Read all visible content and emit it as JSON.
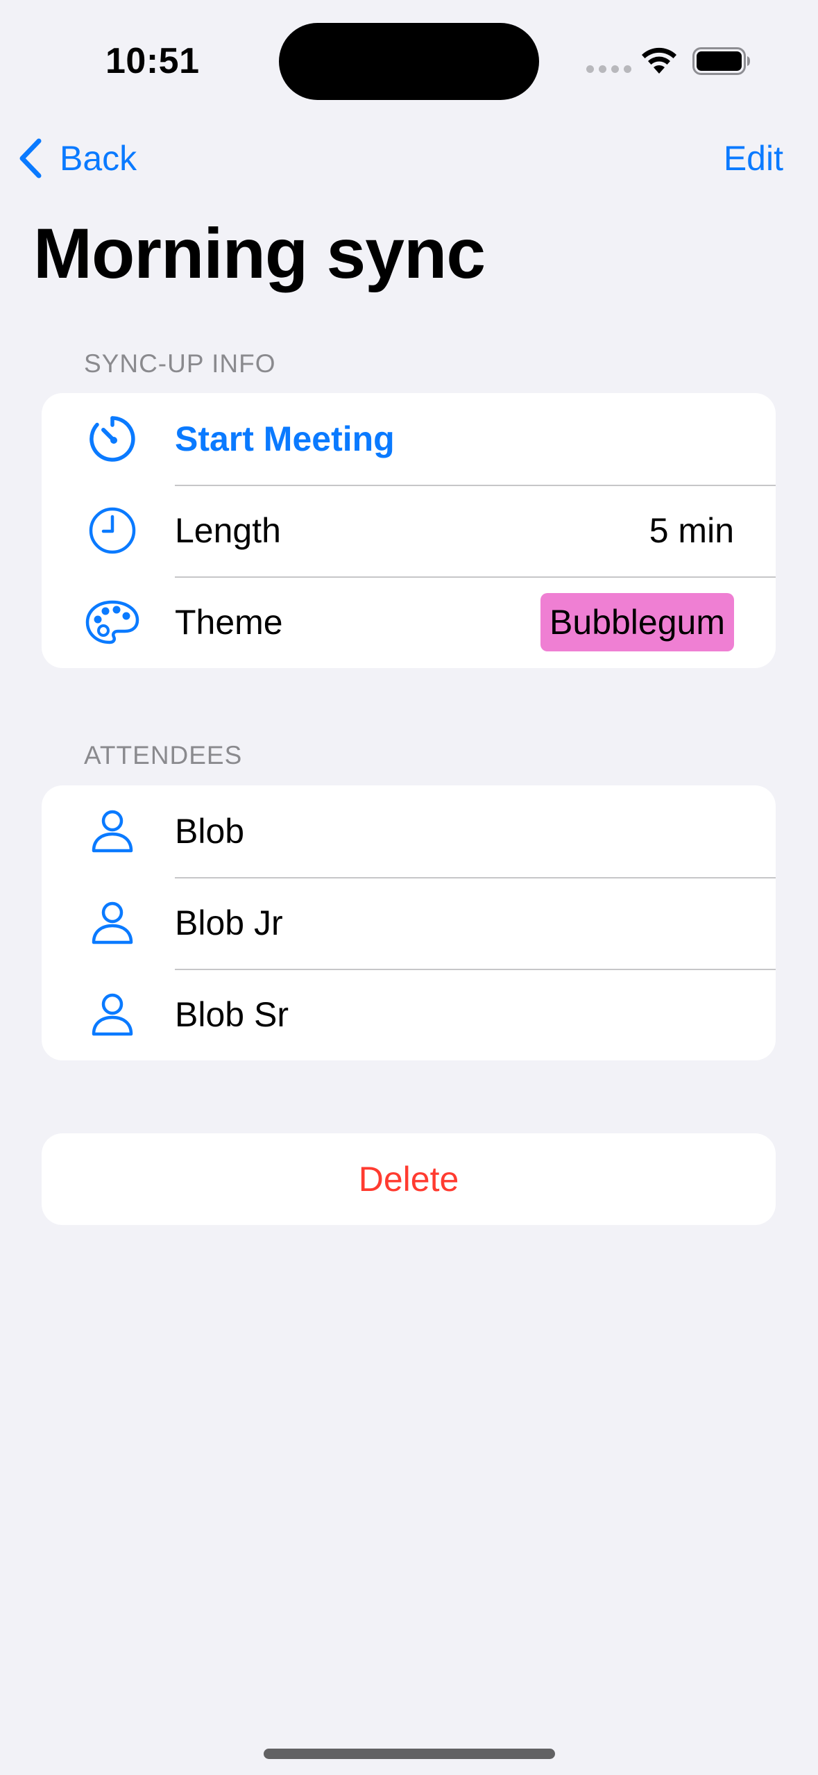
{
  "status_bar": {
    "time": "10:51"
  },
  "nav": {
    "back_label": "Back",
    "edit_label": "Edit"
  },
  "title": "Morning sync",
  "sync_up_info": {
    "header": "SYNC-UP INFO",
    "start_meeting_label": "Start Meeting",
    "length_label": "Length",
    "length_value": "5 min",
    "theme_label": "Theme",
    "theme_value": "Bubblegum",
    "theme_color": "#ef7fd3"
  },
  "attendees": {
    "header": "ATTENDEES",
    "items": [
      {
        "name": "Blob",
        "icon": "person-icon"
      },
      {
        "name": "Blob Jr",
        "icon": "person-icon"
      },
      {
        "name": "Blob Sr",
        "icon": "person-icon"
      }
    ]
  },
  "delete_label": "Delete",
  "colors": {
    "accent": "#0a7aff",
    "destructive": "#ff3b30",
    "background": "#f2f2f7"
  }
}
